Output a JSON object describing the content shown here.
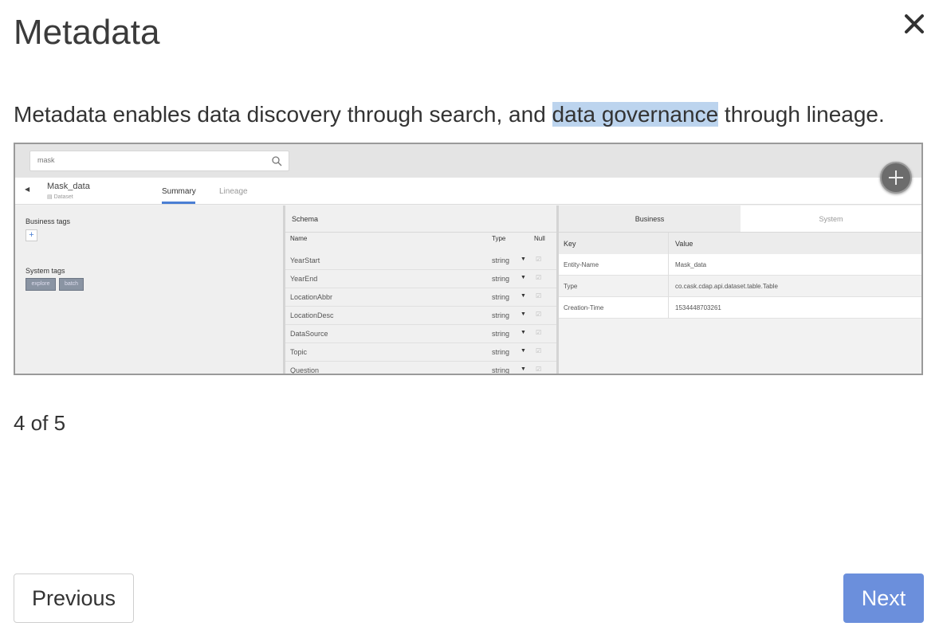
{
  "dialog": {
    "title": "Metadata",
    "close_icon": "close-icon",
    "description_before": "Metadata enables data discovery through search, and ",
    "description_highlight": "data governance",
    "description_after": " through lineage.",
    "counter": "4 of 5",
    "previous_label": "Previous",
    "next_label": "Next",
    "next_color": "#6b8fdc",
    "highlight_color": "#bcd4ee"
  },
  "screenshot": {
    "search_value": "mask",
    "entity_name": "Mask_data",
    "entity_type": "Dataset",
    "tabs": [
      "Summary",
      "Lineage"
    ],
    "business_tags_label": "Business tags",
    "system_tags_label": "System tags",
    "system_tags": [
      "explore",
      "batch"
    ],
    "schema_label": "Schema",
    "schema_columns": [
      "Name",
      "Type",
      "Null"
    ],
    "schema_rows": [
      {
        "name": "YearStart",
        "type": "string"
      },
      {
        "name": "YearEnd",
        "type": "string"
      },
      {
        "name": "LocationAbbr",
        "type": "string"
      },
      {
        "name": "LocationDesc",
        "type": "string"
      },
      {
        "name": "DataSource",
        "type": "string"
      },
      {
        "name": "Topic",
        "type": "string"
      },
      {
        "name": "Question",
        "type": "string"
      }
    ],
    "property_tabs": [
      "Business",
      "System"
    ],
    "kv_headers": [
      "Key",
      "Value"
    ],
    "kv_rows": [
      {
        "key": "Entity-Name",
        "value": "Mask_data"
      },
      {
        "key": "Type",
        "value": "co.cask.cdap.api.dataset.table.Table"
      },
      {
        "key": "Creation-Time",
        "value": "1534448703261"
      }
    ]
  }
}
